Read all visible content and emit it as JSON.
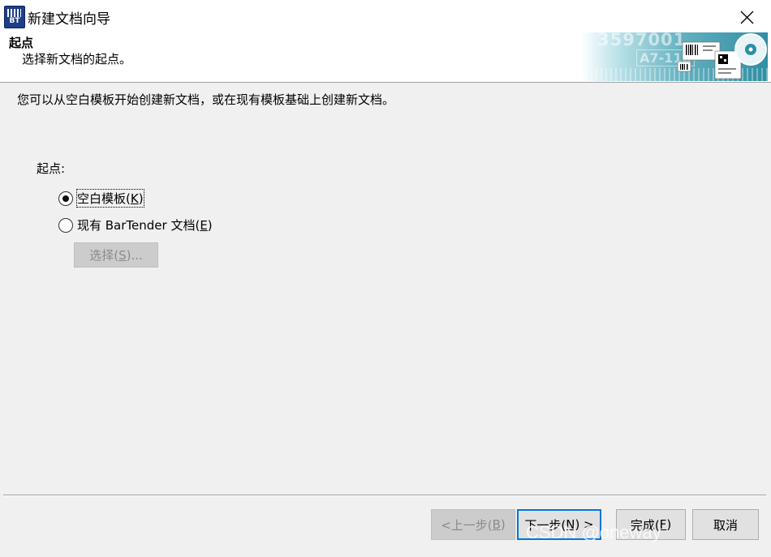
{
  "window": {
    "title": "新建文档向导",
    "icon_text": "BT"
  },
  "header": {
    "title": "起点",
    "subtitle": "选择新文档的起点。",
    "banner_text_1": "3597001",
    "banner_text_2": "A7-118"
  },
  "body": {
    "description": "您可以从空白模板开始创建新文档，或在现有模板基础上创建新文档。",
    "group_label": "起点:",
    "options": [
      {
        "label_pre": "空白模板(",
        "mnemonic": "K",
        "label_post": ")",
        "selected": true
      },
      {
        "label_pre": "现有 BarTender 文档(",
        "mnemonic": "E",
        "label_post": ")",
        "selected": false
      }
    ],
    "select_button": {
      "pre": "选择(",
      "mnemonic": "S",
      "post": ")..."
    }
  },
  "footer": {
    "back": {
      "pre": "<上一步(",
      "mnemonic": "B",
      "post": ")"
    },
    "next": {
      "pre": "下一步(",
      "mnemonic": "N",
      "post": ") >"
    },
    "finish": {
      "pre": "完成(",
      "mnemonic": "F",
      "post": ")"
    },
    "cancel": "取消"
  },
  "watermark": "CSDN @oneway",
  "colors": {
    "accent": "#0078d7",
    "icon_bg": "#1d3f8a",
    "banner": "#2e8ea3"
  }
}
